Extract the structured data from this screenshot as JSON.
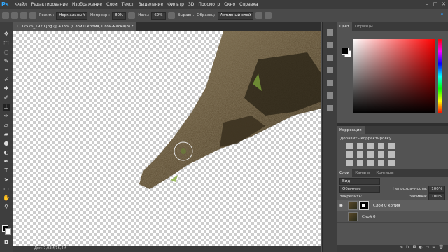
{
  "menu": [
    "Файл",
    "Редактирование",
    "Изображение",
    "Слои",
    "Текст",
    "Выделение",
    "Фильтр",
    "3D",
    "Просмотр",
    "Окно",
    "Справка"
  ],
  "options": {
    "mode_label": "Режим:",
    "mode_value": "Нормальный",
    "opacity_label": "Непрозр.:",
    "opacity_value": "80%",
    "flow_label": "Наж.:",
    "flow_value": "62%",
    "align_label": "Выравн.",
    "sample_label": "Образец:",
    "sample_value": "Активный слой"
  },
  "document": {
    "tab_title": "1132526_1920.jpg @ 433% (Слой 0 копия, Слой-маска/8) *",
    "status": "Док: 7,03М/16,4М"
  },
  "color_panel": {
    "tabs": [
      "Цвет",
      "Образцы"
    ],
    "fg": "#000000",
    "bg": "#ffffff"
  },
  "adjustments": {
    "tab": "Коррекция",
    "hint": "Добавить корректировку"
  },
  "layers_panel": {
    "tabs": [
      "Слои",
      "Каналы",
      "Контуры"
    ],
    "kind": "Вид",
    "blend": "Обычные",
    "opacity_label": "Непрозрачность:",
    "opacity_value": "100%",
    "lock_label": "Закрепить:",
    "fill_label": "Заливка:",
    "fill_value": "100%",
    "layers": [
      {
        "name": "Слой 0 копия",
        "selected": true,
        "visible": true,
        "mask": true
      },
      {
        "name": "Слой 0",
        "selected": false,
        "visible": false,
        "mask": false
      }
    ]
  },
  "accent": "#31a8ff"
}
